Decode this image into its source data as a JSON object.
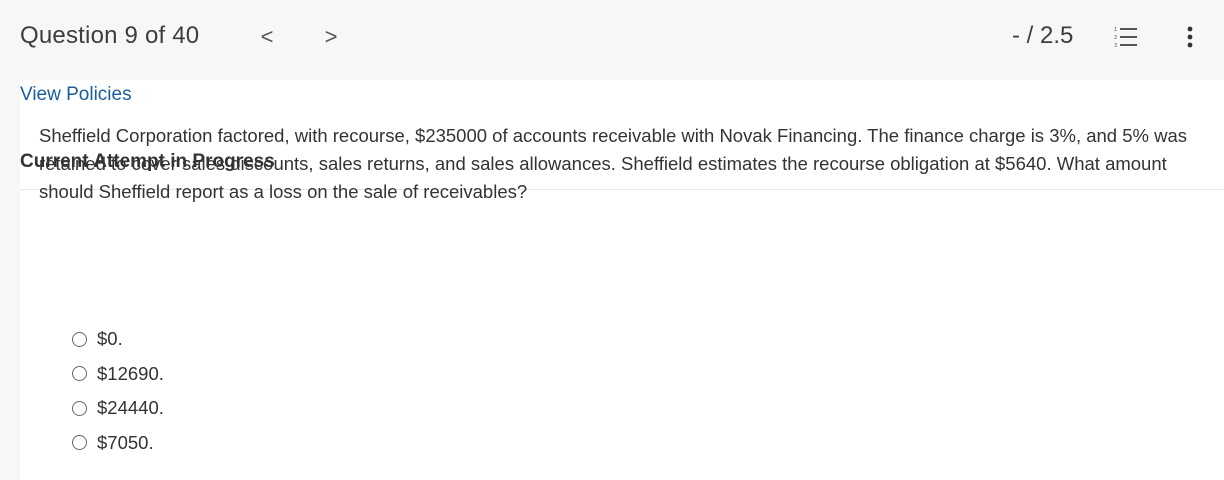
{
  "header": {
    "question_counter": "Question 9 of 40",
    "prev_glyph": "<",
    "next_glyph": ">",
    "score": "- / 2.5",
    "list_icon": "numbered-list-icon",
    "more_icon": "more-vertical-icon"
  },
  "links": {
    "view_policies": "View Policies"
  },
  "attempt": {
    "title": "Current Attempt in Progress"
  },
  "question": {
    "text": "Sheffield Corporation factored, with recourse, $235000 of accounts receivable with Novak Financing. The finance charge is 3%, and 5% was retained to cover sales discounts, sales returns, and sales allowances. Sheffield estimates the recourse obligation at $5640. What amount should Sheffield report as a loss on the sale of receivables?",
    "options": [
      {
        "label": "$0."
      },
      {
        "label": "$12690."
      },
      {
        "label": "$24440."
      },
      {
        "label": "$7050."
      }
    ]
  },
  "colors": {
    "link": "#1a5e9a",
    "background": "#f7f7f7",
    "panel": "#ffffff",
    "text": "#333333"
  }
}
